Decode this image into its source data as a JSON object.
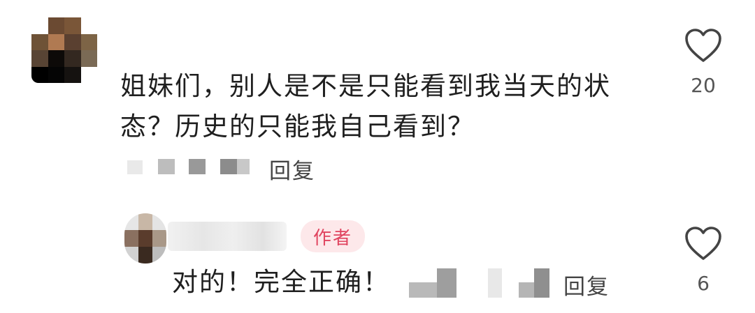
{
  "comment": {
    "text": "姐妹们，别人是不是只能看到我当天的状态？历史的只能我自己看到？",
    "reply_label": "回复",
    "like_count": "20",
    "like_icon": "heart-outline-icon"
  },
  "reply": {
    "author_badge": "作者",
    "text": "对的！完全正确！",
    "reply_label": "回复",
    "like_count": "6",
    "like_icon": "heart-outline-icon"
  },
  "colors": {
    "badge_bg": "#fde8ea",
    "badge_text": "#e0445f"
  }
}
